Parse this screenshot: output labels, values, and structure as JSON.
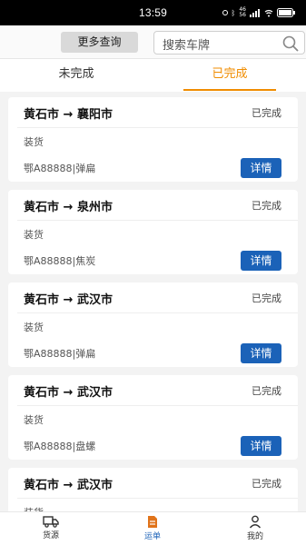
{
  "status_bar": {
    "time": "13:59",
    "battery": "100"
  },
  "search_bar": {
    "more_button": "更多查询",
    "placeholder": "搜索车牌"
  },
  "tabs": [
    {
      "label": "未完成",
      "active": false
    },
    {
      "label": "已完成",
      "active": true
    }
  ],
  "orders": [
    {
      "route": "黄石市 → 襄阳市",
      "status": "已完成",
      "type": "装货",
      "plate": "鄂A88888|弹扁",
      "detail_label": "详情"
    },
    {
      "route": "黄石市 → 泉州市",
      "status": "已完成",
      "type": "装货",
      "plate": "鄂A88888|焦炭",
      "detail_label": "详情"
    },
    {
      "route": "黄石市 → 武汉市",
      "status": "已完成",
      "type": "装货",
      "plate": "鄂A88888|弹扁",
      "detail_label": "详情"
    },
    {
      "route": "黄石市 → 武汉市",
      "status": "已完成",
      "type": "装货",
      "plate": "鄂A88888|盘螺",
      "detail_label": "详情"
    },
    {
      "route": "黄石市 → 武汉市",
      "status": "已完成",
      "type": "装货",
      "plate": "",
      "detail_label": ""
    }
  ],
  "bottom_nav": [
    {
      "label": "货源",
      "icon": "truck-icon",
      "active": false
    },
    {
      "label": "运单",
      "icon": "document-icon",
      "active": true
    },
    {
      "label": "我的",
      "icon": "person-icon",
      "active": false
    }
  ],
  "colors": {
    "accent_orange": "#f08c00",
    "primary_blue": "#1b62b8"
  }
}
